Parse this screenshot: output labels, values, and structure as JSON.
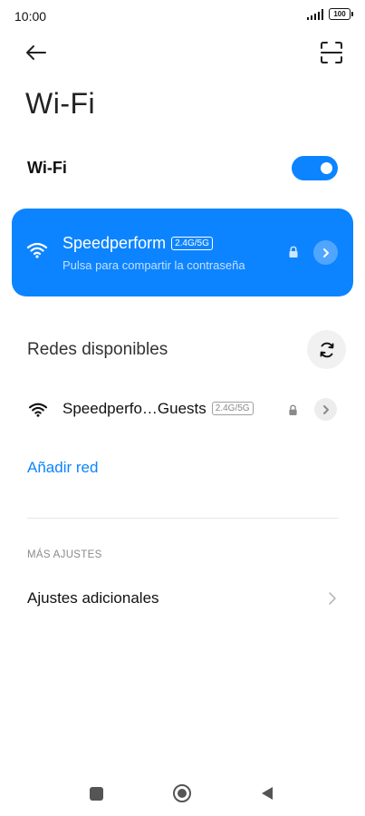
{
  "status_bar": {
    "time": "10:00",
    "battery": "100"
  },
  "header": {
    "title": "Wi-Fi"
  },
  "wifi_toggle": {
    "label": "Wi-Fi",
    "enabled": true
  },
  "connected": {
    "name": "Speedperform",
    "band": "2.4G/5G",
    "subtitle": "Pulsa para compartir la contraseña"
  },
  "available": {
    "title": "Redes disponibles",
    "networks": [
      {
        "name": "Speedperfo…Guests",
        "band": "2.4G/5G",
        "secured": true
      }
    ]
  },
  "add_network": {
    "label": "Añadir red"
  },
  "more_settings": {
    "header": "MÁS AJUSTES",
    "additional_label": "Ajustes adicionales"
  },
  "colors": {
    "accent": "#0d84ff",
    "background": "#ffffff"
  },
  "icons": {
    "back": "arrow-left-icon",
    "scan": "qr-scan-icon",
    "wifi": "wifi-icon",
    "lock": "lock-icon",
    "arrow": "chevron-right-icon",
    "refresh": "refresh-icon"
  }
}
